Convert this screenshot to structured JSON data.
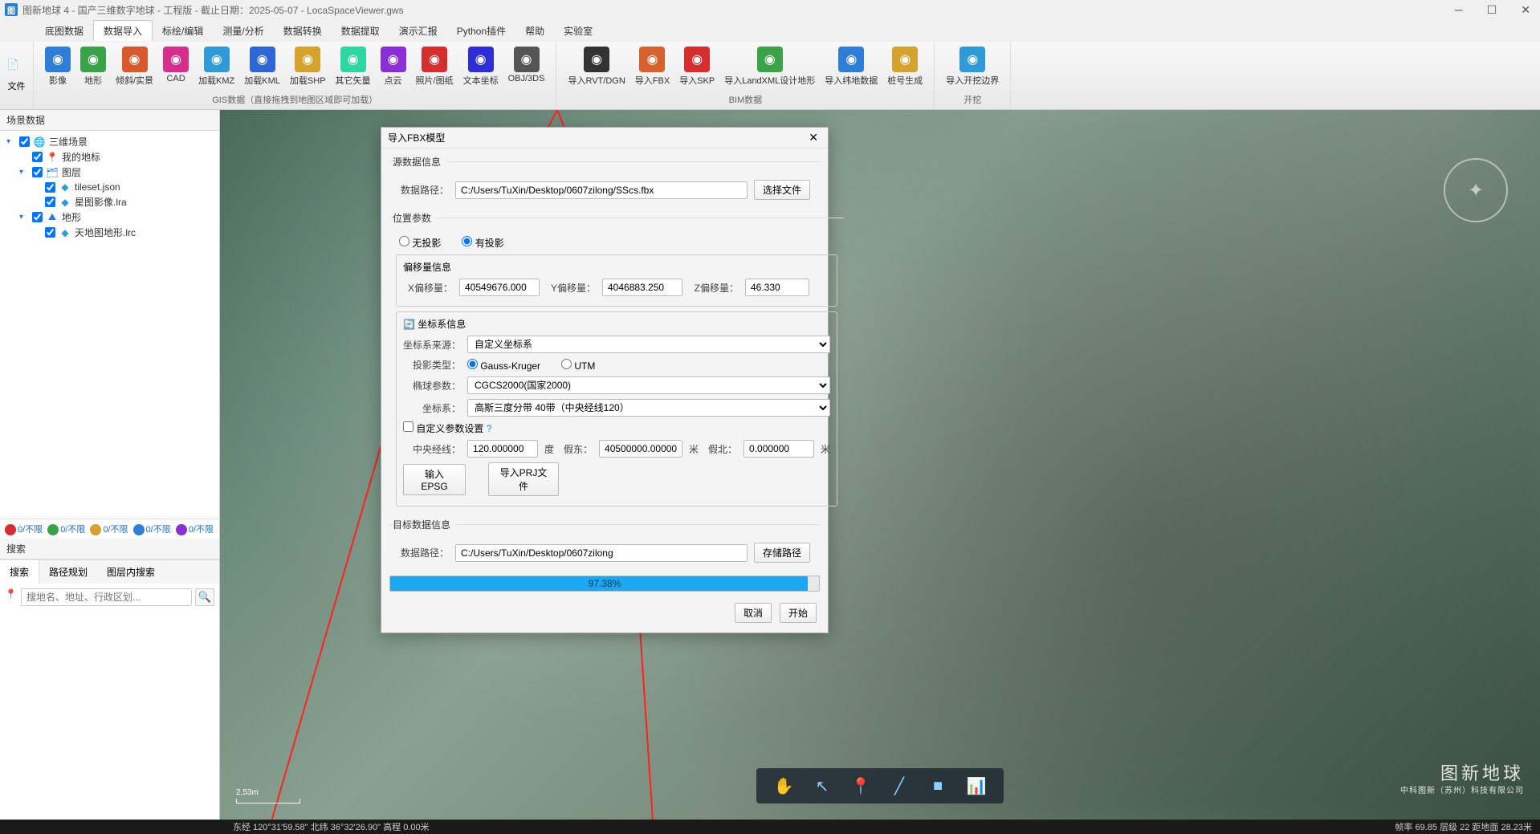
{
  "titlebar": {
    "icon_text": "图",
    "title": "图新地球 4 - 国产三维数字地球 - 工程版 - 截止日期：2025-05-07 - LocaSpaceViewer.gws"
  },
  "menu": {
    "tabs": [
      "底图数据",
      "数据导入",
      "标绘/编辑",
      "测量/分析",
      "数据转换",
      "数据提取",
      "演示汇报",
      "Python插件",
      "帮助",
      "实验室"
    ],
    "active_index": 1
  },
  "ribbon": {
    "file_label": "文件",
    "groups": [
      {
        "label": "GIS数据（直接拖拽到地图区域即可加载）",
        "items": [
          {
            "label": "影像",
            "color": "#2e7dd6"
          },
          {
            "label": "地形",
            "color": "#3aa34a"
          },
          {
            "label": "倾斜/实景",
            "color": "#d65a2e"
          },
          {
            "label": "CAD",
            "color": "#d62e8a"
          },
          {
            "label": "加载KMZ",
            "color": "#2e9bd6"
          },
          {
            "label": "加载KML",
            "color": "#2e66d6"
          },
          {
            "label": "加载SHP",
            "color": "#d6a22e"
          },
          {
            "label": "其它矢量",
            "color": "#2ed6a2"
          },
          {
            "label": "点云",
            "color": "#8a2ed6"
          },
          {
            "label": "照片/图纸",
            "color": "#d62e2e"
          },
          {
            "label": "文本坐标",
            "color": "#2e2ed6"
          },
          {
            "label": "OBJ/3DS",
            "color": "#555"
          }
        ]
      },
      {
        "label": "BIM数据",
        "items": [
          {
            "label": "导入RVT/DGN",
            "color": "#333"
          },
          {
            "label": "导入FBX",
            "color": "#d6612e"
          },
          {
            "label": "导入SKP",
            "color": "#d62e2e"
          },
          {
            "label": "导入LandXML设计地形",
            "color": "#3aa34a"
          },
          {
            "label": "导入纬地数据",
            "color": "#2e7dd6"
          },
          {
            "label": "桩号生成",
            "color": "#d6a22e"
          }
        ]
      },
      {
        "label": "开挖",
        "items": [
          {
            "label": "导入开挖边界",
            "color": "#2e9bd6"
          }
        ]
      }
    ]
  },
  "sidebar": {
    "scene_panel_title": "场景数据",
    "tree": [
      {
        "indent": 0,
        "caret": "▾",
        "checked": true,
        "icon": "🌐",
        "label": "三维场景",
        "color": "#2b7cd3"
      },
      {
        "indent": 1,
        "caret": "",
        "checked": true,
        "icon": "📍",
        "label": "我的地标",
        "color": "#d65a2e"
      },
      {
        "indent": 1,
        "caret": "▾",
        "checked": true,
        "icon": "🗂",
        "label": "图层",
        "color": "#2b7cd3"
      },
      {
        "indent": 2,
        "caret": "",
        "checked": true,
        "icon": "◆",
        "label": "tileset.json",
        "color": "#2e9bd6"
      },
      {
        "indent": 2,
        "caret": "",
        "checked": true,
        "icon": "◆",
        "label": "星图影像.lra",
        "color": "#2e9bd6"
      },
      {
        "indent": 1,
        "caret": "▾",
        "checked": true,
        "icon": "⛰",
        "label": "地形",
        "color": "#2b7cd3"
      },
      {
        "indent": 2,
        "caret": "",
        "checked": true,
        "icon": "◆",
        "label": "天地图地形.lrc",
        "color": "#2e9bd6"
      }
    ],
    "filters": [
      {
        "color": "#d62e2e",
        "text": "0/不限"
      },
      {
        "color": "#3aa34a",
        "text": "0/不限"
      },
      {
        "color": "#d6a22e",
        "text": "0/不限"
      },
      {
        "color": "#2e7dd6",
        "text": "0/不限"
      },
      {
        "color": "#8a2ed6",
        "text": "0/不限"
      }
    ],
    "search_panel_title": "搜索",
    "search_tabs": [
      "搜索",
      "路径规划",
      "图层内搜索"
    ],
    "search_placeholder": "搜地名、地址、行政区划..."
  },
  "dialog": {
    "title": "导入FBX模型",
    "source_section": "源数据信息",
    "source_path_label": "数据路径：",
    "source_path": "C:/Users/TuXin/Desktop/0607zilong/SScs.fbx",
    "choose_file": "选择文件",
    "pos_section": "位置参数",
    "no_proj": "无投影",
    "has_proj": "有投影",
    "offset_section": "偏移量信息",
    "x_offset_label": "X偏移量：",
    "x_offset": "40549676.000",
    "y_offset_label": "Y偏移量：",
    "y_offset": "4046883.250",
    "z_offset_label": "Z偏移量：",
    "z_offset": "46.330",
    "crs_section": "坐标系信息",
    "crs_source_label": "坐标系来源：",
    "crs_source": "自定义坐标系",
    "proj_type_label": "投影类型：",
    "proj_gk": "Gauss-Kruger",
    "proj_utm": "UTM",
    "ellipsoid_label": "椭球参数：",
    "ellipsoid": "CGCS2000(国家2000)",
    "crs_label": "坐标系：",
    "crs_value": "高斯三度分带 40带（中央经线120）",
    "custom_params": "自定义参数设置",
    "central_meridian_label": "中央经线：",
    "central_meridian": "120.000000",
    "degree_unit": "度",
    "false_east_label": "假东：",
    "false_east": "40500000.000000",
    "meter_unit": "米",
    "false_north_label": "假北：",
    "false_north": "0.000000",
    "input_epsg": "输入EPSG",
    "import_prj": "导入PRJ文件",
    "target_section": "目标数据信息",
    "target_path_label": "数据路径：",
    "target_path": "C:/Users/TuXin/Desktop/0607zilong",
    "save_path": "存储路径",
    "progress_pct": 97.38,
    "progress_label": "97.38%",
    "cancel": "取消",
    "start": "开始"
  },
  "viewport": {
    "scale_text": "2.53m",
    "tools": [
      "✋",
      "↖",
      "📍",
      "╱",
      "■",
      "📊"
    ],
    "watermark_title": "图新地球",
    "watermark_sub": "中科图新（苏州）科技有限公司",
    "compass_text": "✦"
  },
  "statusbar": {
    "coords": "东经 120°31'59.58\" 北纬 36°32'26.90\"  高程 0.00米",
    "right": "帧率 69.85  层级 22  距地面 28.23米"
  }
}
